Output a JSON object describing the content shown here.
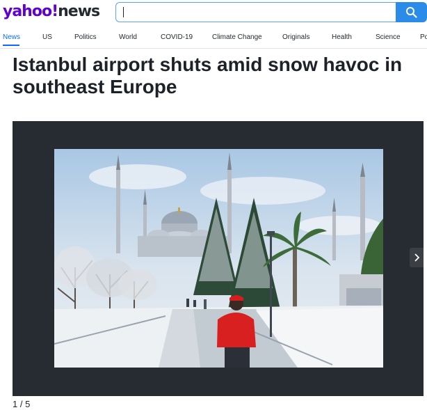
{
  "header": {
    "logo": {
      "yahoo": "yahoo!",
      "news": "news"
    },
    "search": {
      "value": "",
      "placeholder": ""
    },
    "search_button_icon": "search-icon"
  },
  "nav": {
    "items": [
      {
        "label": "News",
        "active": true
      },
      {
        "label": "US",
        "active": false
      },
      {
        "label": "Politics",
        "active": false
      },
      {
        "label": "World",
        "active": false
      },
      {
        "label": "COVID-19",
        "active": false
      },
      {
        "label": "Climate Change",
        "active": false
      },
      {
        "label": "Originals",
        "active": false
      },
      {
        "label": "Health",
        "active": false
      },
      {
        "label": "Science",
        "active": false
      },
      {
        "label": "Po",
        "active": false
      }
    ]
  },
  "article": {
    "headline": "Istanbul airport shuts amid snow havoc in southeast Europe"
  },
  "slideshow": {
    "counter": "1 / 5",
    "next_icon": "chevron-right-icon"
  },
  "colors": {
    "brand": "#6001d2",
    "accent": "#0f69ff",
    "search_button": "#2a8ce8",
    "slideshow_bg": "#272c33"
  }
}
